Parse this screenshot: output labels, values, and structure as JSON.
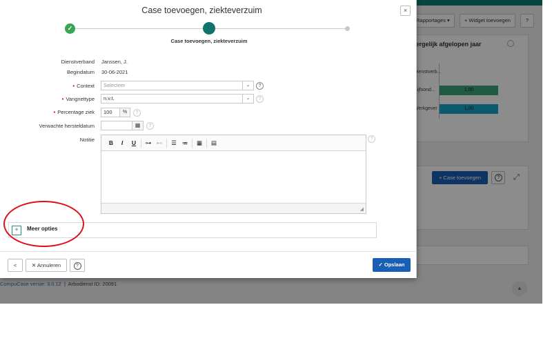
{
  "background": {
    "rapportages_label": "Rapportages",
    "widget_add_label": "+ Widget toevoegen",
    "widget_title": "Vergelijk afgelopen jaar",
    "bars": [
      {
        "label": "Dienstverb...",
        "value": ""
      },
      {
        "label": "Bijfsond...",
        "value": "1,00"
      },
      {
        "label": "Werkgever",
        "value": "1,00"
      }
    ],
    "case_add_label": "Case toevoegen",
    "footer_version": "CompuCase versie: 3.0.12",
    "footer_arbodienst": "Arbodienst ID: 20091"
  },
  "modal": {
    "title": "Case toevoegen, ziekteverzuim",
    "close": "×",
    "step_label": "Case toevoegen, ziekteverzuim",
    "fields": {
      "dienstverband_label": "Dienstverband",
      "dienstverband_value": "Janssen, J.",
      "begindatum_label": "Begindatum",
      "begindatum_value": "30-06-2021",
      "context_label": "Context",
      "context_placeholder": "Selecteer",
      "vangnettype_label": "Vangnettype",
      "vangnettype_value": "n.v.t.",
      "percentage_label": "Percentage ziek",
      "percentage_value": "100",
      "percentage_unit": "%",
      "hersteldatum_label": "Verwachte hersteldatum",
      "notitie_label": "Notitie"
    },
    "toolbar": {
      "bold": "B",
      "italic": "I",
      "underline": "U"
    },
    "meer_opties": "Meer opties",
    "footer": {
      "back": "<",
      "annuleren": "✕ Annuleren",
      "help": "?",
      "opslaan": "✓ Opslaan"
    }
  }
}
